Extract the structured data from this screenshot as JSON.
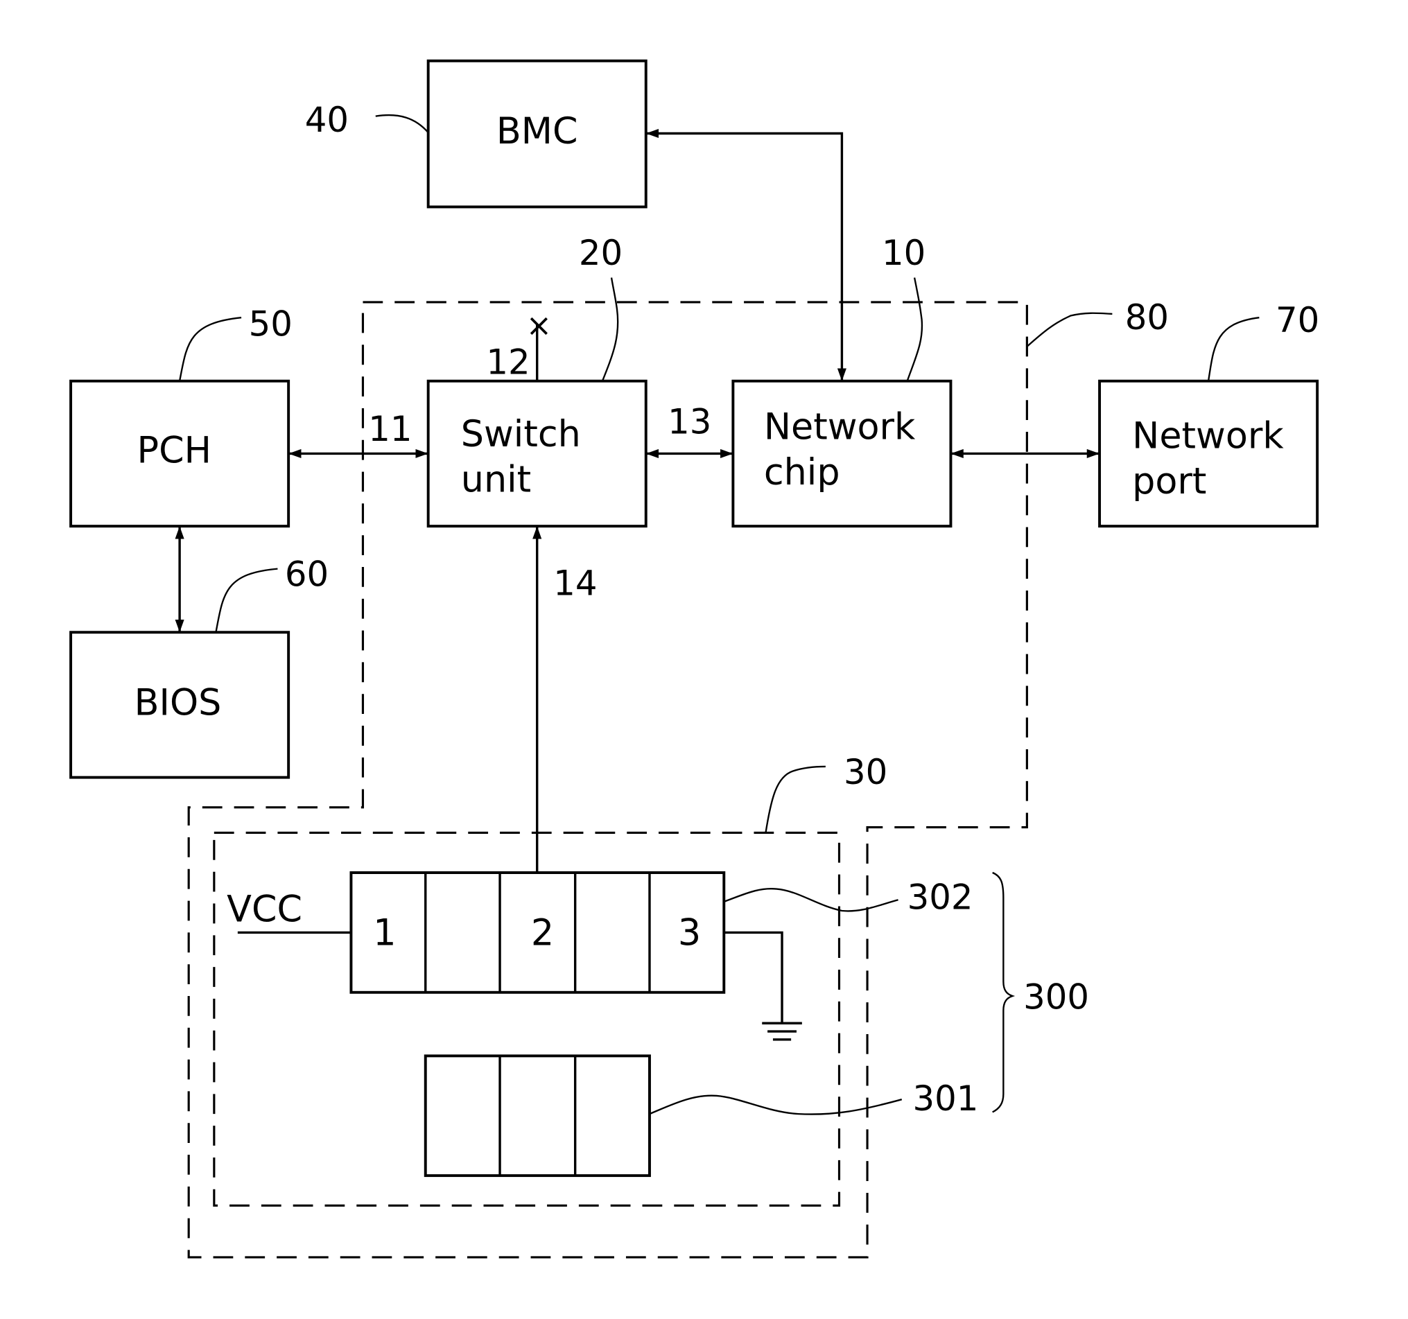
{
  "diagram": {
    "blocks": {
      "bmc": {
        "label": "BMC",
        "ref": "40"
      },
      "pch": {
        "label": "PCH",
        "ref": "50"
      },
      "bios": {
        "label": "BIOS",
        "ref": "60"
      },
      "switch_unit": {
        "label_line1": "Switch",
        "label_line2": "unit",
        "ref": "20"
      },
      "network_chip": {
        "label_line1": "Network",
        "label_line2": "chip",
        "ref": "10"
      },
      "network_port": {
        "label_line1": "Network",
        "label_line2": "port",
        "ref": "70"
      }
    },
    "regions": {
      "outer": {
        "ref": "80"
      },
      "jumper_circuit": {
        "ref": "30"
      }
    },
    "connections": {
      "pch_switch": "11",
      "switch_unused": "12",
      "switch_chip": "13",
      "jumper_switch": "14"
    },
    "jumper": {
      "header_ref": "302",
      "cap_ref": "301",
      "assembly_ref": "300",
      "vcc_label": "VCC",
      "pins": [
        "1",
        "2",
        "3"
      ],
      "unused_marker": "×"
    }
  }
}
